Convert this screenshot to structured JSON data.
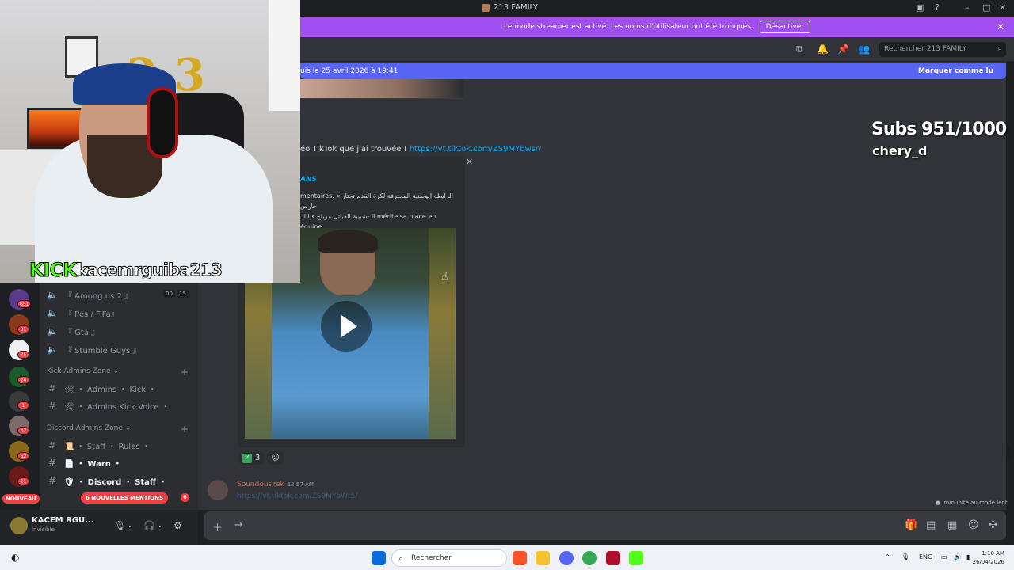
{
  "window": {
    "title": "213 FAMILY"
  },
  "banner": {
    "message": "Le mode streamer est activé. Les noms d'utilisateur ont été tronqués.",
    "button": "Désactiver"
  },
  "header": {
    "search_placeholder": "Rechercher 213 FAMILY"
  },
  "newbar": {
    "left_text": "uis le 25 avril 2026 à 19:41",
    "right_text": "Marquer comme lu"
  },
  "message": {
    "text": "éo TikTok que j'ai trouvée !",
    "link": "https://vt.tiktok.com/ZS9MYbwsr/",
    "embed_title": "ANS",
    "embed_desc_1": "mentaires. « الرابطة الوطنية المحترفة لكرة القدم تختار حارس",
    "embed_desc_2": "شبيبة القبائل مرباح قيا الـ- il mérite sa place en équipe",
    "reaction_count": "3"
  },
  "next_message": {
    "author": "Soundouszek",
    "time": "12:57 AM",
    "link": "https://vt.tiktok.com/ZS9MYbWt5/"
  },
  "slowmode": "Immunité au mode lent",
  "overlay": {
    "kick_label": "KICK",
    "kick_user": "kacemrguiba213",
    "subs": "Subs 951/1000",
    "sub_user": "chery_d"
  },
  "servers": [
    {
      "badge": "651",
      "color": "#5a3a8a"
    },
    {
      "badge": "31",
      "color": "#8a3a1a"
    },
    {
      "badge": "75",
      "color": "#f0f0f0"
    },
    {
      "badge": "24",
      "color": "#1a5a2a"
    },
    {
      "badge": "1",
      "color": "#3a3a3a"
    },
    {
      "badge": "47",
      "color": "#7a6a6a"
    },
    {
      "badge": "62",
      "color": "#8a6a1a"
    },
    {
      "badge": "21",
      "color": "#6a1a1a"
    }
  ],
  "nouveau": "NOUVEAU",
  "channels": {
    "voice": [
      {
        "label": "『 Among us 2 』",
        "count_a": "00",
        "count_b": "15"
      },
      {
        "label": "『 Pes / FiFa』"
      },
      {
        "label": "『 Gta 』"
      },
      {
        "label": "『 Stumble Guys 』"
      }
    ],
    "cat1": "Kick Admins Zone",
    "cat1_items": [
      "🛠 ・ Admins ・ Kick ・",
      "🛠 ・ Admins Kick Voice ・"
    ],
    "cat2": "Discord Admins Zone",
    "cat2_items": [
      "📜 ・ Staff ・ Rules ・",
      "📄 ・ Warn ・",
      "🛡 ・ Discord ・ Staff ・"
    ],
    "mentions": "6 NOUVELLES MENTIONS",
    "mentions_count": "6"
  },
  "user": {
    "name": "KACEM RGU...",
    "status": "Invisible"
  },
  "taskbar": {
    "search": "Rechercher",
    "lang": "ENG",
    "time": "1:10 AM",
    "date": "26/04/2026"
  },
  "colors": {
    "accent": "#5865f2",
    "banner": "#a14ff0",
    "kick": "#53fc18"
  }
}
